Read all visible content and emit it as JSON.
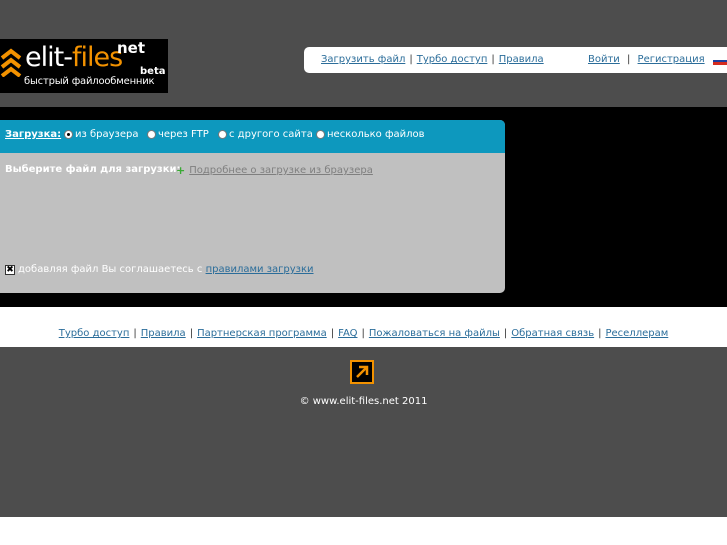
{
  "logo": {
    "name_part1": "elit-",
    "name_part2": "files",
    "net": "net",
    "beta": "beta",
    "tagline": "быстрый файлообменник"
  },
  "topnav": {
    "left": [
      "Загрузить файл",
      "Турбо доступ",
      "Правила"
    ],
    "right": [
      "Войти",
      "Регистрация"
    ]
  },
  "upload": {
    "label": "Загрузка:",
    "options": [
      "из браузера",
      "через FTP",
      "с другого сайта",
      "несколько файлов"
    ],
    "selected": "из браузера",
    "choose_label": "Выберите файл для загрузки:",
    "more_link": "Подробнее о загрузке из браузера",
    "agree_text": "добавляя файл Вы соглашаетесь с",
    "agree_link": "правилами загрузки"
  },
  "footer": {
    "links": [
      "Турбо доступ",
      "Правила",
      "Партнерская программа",
      "FAQ",
      "Пожаловаться на файлы",
      "Обратная связь",
      "Реселлерам"
    ],
    "copyright": "© www.elit-files.net 2011"
  },
  "colors": {
    "accent": "#f39200",
    "header_bg": "#4d4d4d",
    "panel_head": "#0d98be",
    "panel_bg": "#c0c0c0",
    "link": "#2b6d9a"
  }
}
